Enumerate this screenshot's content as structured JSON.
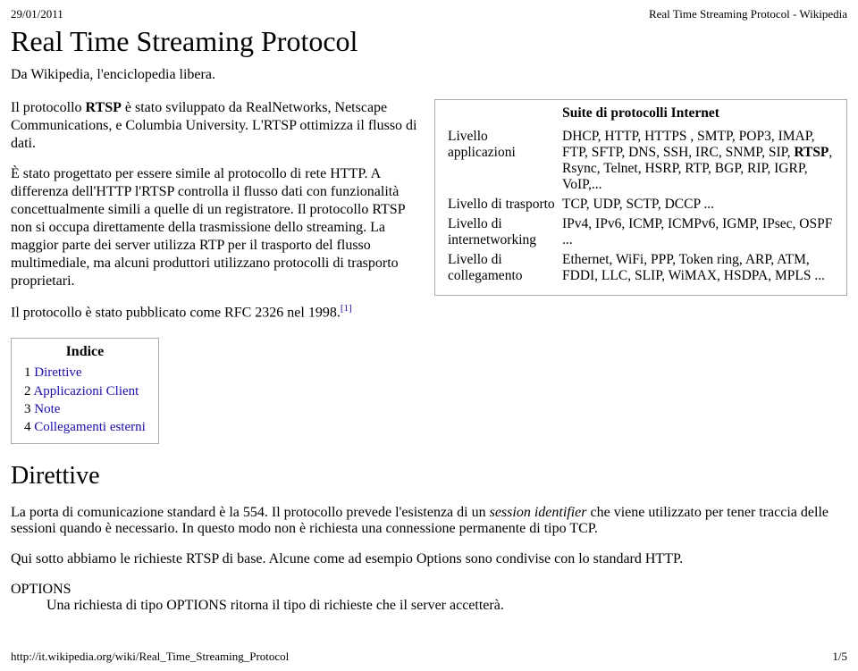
{
  "top": {
    "date": "29/01/2011",
    "header": "Real Time Streaming Protocol - Wikipedia"
  },
  "title": "Real Time Streaming Protocol",
  "subtitle": "Da Wikipedia, l'enciclopedia libera.",
  "para1_pre": "Il protocollo ",
  "para1_bold": "RTSP",
  "para1_post": " è stato sviluppato da RealNetworks, Netscape Communications, e Columbia University. L'RTSP ottimizza il flusso di dati.",
  "para2": "È stato progettato per essere simile al protocollo di rete HTTP. A differenza dell'HTTP l'RTSP controlla il flusso dati con funzionalità concettualmente simili a quelle di un registratore. Il protocollo RTSP non si occupa direttamente della trasmissione dello streaming. La maggior parte dei server utilizza RTP per il trasporto del flusso multimediale, ma alcuni produttori utilizzano protocolli di trasporto proprietari.",
  "para3": "Il protocollo è stato pubblicato come RFC 2326 nel 1998.",
  "para3_sup": "[1]",
  "infobox": {
    "title": "Suite di protocolli Internet",
    "rows": [
      {
        "label": "Livello applicazioni",
        "value_pre": "DHCP, HTTP, HTTPS , SMTP, POP3, IMAP, FTP, SFTP, DNS, SSH, IRC, SNMP, SIP, ",
        "value_bold": "RTSP",
        "value_post": ", Rsync, Telnet, HSRP, RTP, BGP, RIP, IGRP, VoIP,..."
      },
      {
        "label": "Livello di trasporto",
        "value_pre": "TCP, UDP, SCTP, DCCP ...",
        "value_bold": "",
        "value_post": ""
      },
      {
        "label": "Livello di internetworking",
        "value_pre": "IPv4, IPv6, ICMP, ICMPv6, IGMP, IPsec, OSPF ...",
        "value_bold": "",
        "value_post": ""
      },
      {
        "label": "Livello di collegamento",
        "value_pre": "Ethernet, WiFi, PPP, Token ring, ARP, ATM, FDDI, LLC, SLIP, WiMAX, HSDPA, MPLS ...",
        "value_bold": "",
        "value_post": ""
      }
    ]
  },
  "toc": {
    "title": "Indice",
    "items": [
      {
        "num": "1",
        "label": "Direttive"
      },
      {
        "num": "2",
        "label": "Applicazioni Client"
      },
      {
        "num": "3",
        "label": "Note"
      },
      {
        "num": "4",
        "label": "Collegamenti esterni"
      }
    ]
  },
  "section_title": "Direttive",
  "s_para1_pre": "La porta di comunicazione standard è la 554. Il protocollo prevede l'esistenza di un ",
  "s_para1_em": "session identifier",
  "s_para1_post": " che viene utilizzato per tener traccia delle sessioni quando è necessario. In questo modo non è richiesta una connessione permanente di tipo TCP.",
  "s_para2": "Qui sotto abbiamo le richieste RTSP di base. Alcune come ad esempio Options sono condivise con lo standard HTTP.",
  "dl": {
    "term": "OPTIONS",
    "def": "Una richiesta di tipo OPTIONS ritorna il tipo di richieste che il server accetterà."
  },
  "footer": {
    "url": "http://it.wikipedia.org/wiki/Real_Time_Streaming_Protocol",
    "page": "1/5"
  }
}
